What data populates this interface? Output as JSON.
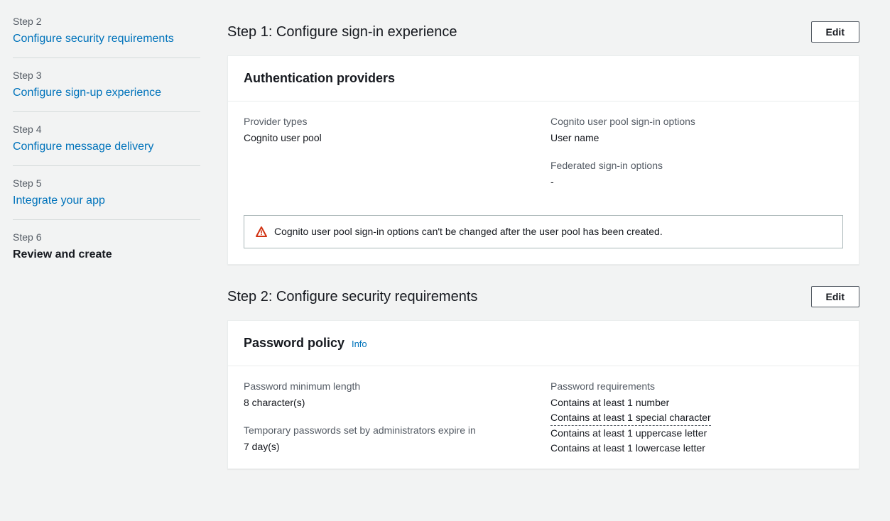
{
  "sidebar": {
    "steps": [
      {
        "num": "Step 2",
        "label": "Configure security requirements",
        "current": false
      },
      {
        "num": "Step 3",
        "label": "Configure sign-up experience",
        "current": false
      },
      {
        "num": "Step 4",
        "label": "Configure message delivery",
        "current": false
      },
      {
        "num": "Step 5",
        "label": "Integrate your app",
        "current": false
      },
      {
        "num": "Step 6",
        "label": "Review and create",
        "current": true
      }
    ]
  },
  "step1": {
    "title": "Step 1: Configure sign-in experience",
    "edit": "Edit",
    "panel_title": "Authentication providers",
    "provider_types_label": "Provider types",
    "provider_types_value": "Cognito user pool",
    "signin_options_label": "Cognito user pool sign-in options",
    "signin_options_value": "User name",
    "federated_label": "Federated sign-in options",
    "federated_value": "-",
    "warning": "Cognito user pool sign-in options can't be changed after the user pool has been created."
  },
  "step2": {
    "title": "Step 2: Configure security requirements",
    "edit": "Edit",
    "panel_title": "Password policy",
    "info": "Info",
    "min_length_label": "Password minimum length",
    "min_length_value": "8 character(s)",
    "temp_pw_label": "Temporary passwords set by administrators expire in",
    "temp_pw_value": "7 day(s)",
    "requirements_label": "Password requirements",
    "req1": "Contains at least 1 number",
    "req2": "Contains at least 1 special character",
    "req3": "Contains at least 1 uppercase letter",
    "req4": "Contains at least 1 lowercase letter"
  }
}
